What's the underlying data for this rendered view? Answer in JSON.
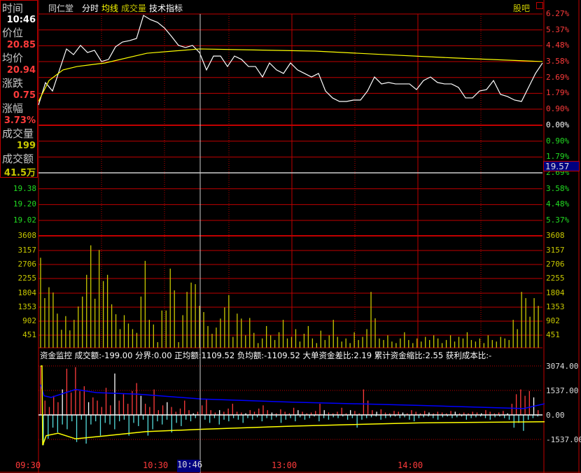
{
  "info_panel": {
    "time_label": "时间",
    "time_value": "10:46",
    "price_label": "价位",
    "price_value": "20.85",
    "avg_label": "均价",
    "avg_value": "20.94",
    "change_label": "涨跌",
    "change_value": "0.75",
    "pct_label": "涨幅",
    "pct_value": "3.73%",
    "volume_label": "成交量",
    "volume_value": "199",
    "amount_label": "成交额",
    "amount_value": "41.5万"
  },
  "header": {
    "stock_name": "同仁堂",
    "tabs": [
      "分时",
      "均线",
      "成交量",
      "技术指标"
    ],
    "guba": "股吧"
  },
  "price_axis_right": [
    "6.27%",
    "5.37%",
    "4.48%",
    "3.58%",
    "2.69%",
    "1.79%",
    "0.90%",
    "0.00%",
    "0.90%",
    "1.79%",
    "2.69%",
    "3.58%",
    "4.48%",
    "5.37%"
  ],
  "price_axis_left": [
    "19.38",
    "19.20",
    "19.02"
  ],
  "cursor_price": "19.57",
  "volume_axis": [
    "3608",
    "3157",
    "2706",
    "2255",
    "1804",
    "1353",
    "902",
    "451"
  ],
  "fund_monitor": {
    "text": "资金监控  成交额:-199.00  分界:0.00  正均额:1109.52  负均额:-1109.52  大单资金差比:2.19  累计资金缩比:2.55  获利成本比:-",
    "axis": [
      "3074.00",
      "1537.00",
      "0.00",
      "-1537.00"
    ]
  },
  "time_axis": [
    "09:30",
    "10:30",
    "10:46",
    "13:00",
    "14:00"
  ],
  "colors": {
    "up": "#ff3b3b",
    "down": "#22dd22",
    "avg": "#ffff00",
    "vol": "#c8c800",
    "grid": "#c00000",
    "cursor_bg": "#000080"
  },
  "chart_data": {
    "type": "line",
    "price_pct": [
      1.14,
      2.4,
      1.93,
      3.12,
      4.3,
      3.98,
      4.5,
      4.1,
      4.22,
      3.59,
      3.71,
      4.42,
      4.69,
      4.77,
      4.89,
      6.19,
      5.95,
      5.8,
      5.48,
      5.01,
      4.5,
      4.38,
      4.5,
      4.1,
      3.12,
      3.9,
      3.9,
      3.31,
      3.9,
      3.71,
      3.31,
      3.31,
      2.72,
      3.51,
      3.12,
      2.92,
      3.51,
      3.12,
      2.92,
      2.72,
      2.92,
      1.93,
      1.54,
      1.34,
      1.34,
      1.42,
      1.42,
      1.93,
      2.72,
      2.33,
      2.41,
      2.33,
      2.33,
      2.33,
      2.01,
      2.52,
      2.72,
      2.41,
      2.33,
      2.33,
      2.13,
      1.54,
      1.54,
      1.93,
      2.01,
      2.52,
      1.74,
      1.62,
      1.42,
      1.34,
      2.13,
      2.92,
      3.51
    ],
    "avg_pct": [
      [
        0,
        1.34
      ],
      [
        15,
        2.52
      ],
      [
        35,
        3.12
      ],
      [
        55,
        3.31
      ],
      [
        95,
        3.51
      ],
      [
        155,
        4.06
      ],
      [
        230,
        4.3
      ],
      [
        395,
        4.18
      ],
      [
        495,
        3.98
      ],
      [
        595,
        3.79
      ],
      [
        720,
        3.59
      ]
    ],
    "volume": [
      2900,
      1600,
      1950,
      1780,
      1100,
      580,
      1020,
      560,
      900,
      1330,
      1650,
      2350,
      3300,
      1580,
      3150,
      2150,
      2350,
      1400,
      1080,
      600,
      1050,
      780,
      600,
      480,
      1650,
      2800,
      900,
      750,
      180,
      1200,
      1200,
      2550,
      1850,
      180,
      1050,
      1800,
      2100,
      2050,
      1350,
      1150,
      700,
      450,
      650,
      940,
      1300,
      1700,
      350,
      1100,
      940,
      400,
      960,
      480,
      150,
      300,
      700,
      400,
      250,
      500,
      900,
      300,
      350,
      600,
      200,
      450,
      700,
      300,
      150,
      550,
      250,
      400,
      900,
      350,
      200,
      300,
      150,
      500,
      250,
      350,
      600,
      1800,
      950,
      300,
      250,
      400,
      200,
      150,
      300,
      500,
      250,
      150,
      300,
      200,
      350,
      250,
      400,
      300,
      150,
      250,
      400,
      200,
      350,
      300,
      500,
      250,
      200,
      300,
      150,
      400,
      250,
      200,
      350,
      300,
      250,
      900,
      600,
      1800,
      1600,
      1000,
      1600,
      1350
    ],
    "fund_pos": [
      3074,
      900,
      500,
      1200,
      800,
      1600,
      2900,
      1400,
      3000,
      1500,
      1800,
      800,
      1100,
      900,
      500,
      1700,
      600,
      2600,
      900,
      1300,
      700,
      1500,
      2000,
      1200,
      700,
      500,
      1600,
      300,
      600,
      800,
      500,
      200,
      400,
      900,
      300,
      100,
      200,
      600,
      1000,
      300,
      150,
      300,
      200,
      400,
      700,
      200,
      150,
      100,
      300,
      200,
      400,
      600,
      300,
      150,
      100,
      350,
      200,
      100,
      450,
      300,
      200,
      100,
      150,
      250,
      700,
      300,
      150,
      100,
      200,
      450,
      100,
      300,
      250,
      100,
      1600,
      900,
      300,
      200,
      350,
      150,
      100,
      250,
      200,
      150,
      100,
      300,
      200,
      100,
      250,
      150,
      100,
      200,
      150,
      100,
      250,
      200,
      100,
      150,
      100,
      200,
      150,
      100,
      300,
      200,
      100,
      150,
      250,
      100,
      700,
      1300,
      1600,
      1200,
      1500,
      1100,
      300
    ],
    "fund_neg": [
      -1900,
      -1500,
      -800,
      -1100,
      -600,
      -900,
      -400,
      -1700,
      -300,
      -1800,
      -600,
      -400,
      -1300,
      -500,
      -600,
      -900,
      -400,
      -300,
      -1300,
      -500,
      -700,
      -300,
      -1300,
      -900,
      -400,
      -600,
      -300,
      -1100,
      -500,
      -700,
      -300,
      -400,
      -200,
      -800,
      -300,
      -500,
      -200,
      -600,
      -300,
      -400,
      -200,
      -300,
      -500,
      -200,
      -300,
      -150,
      -400,
      -200,
      -300,
      -150,
      -500,
      -300,
      -200,
      -400,
      -150,
      -300,
      -200,
      -100,
      -400,
      -200,
      -300,
      -150,
      -200,
      -100,
      -300,
      -200,
      -800,
      -300,
      -200,
      -150,
      -100,
      -300,
      -200,
      -150,
      -100,
      -200,
      -150,
      -300,
      -400,
      -200,
      -150,
      -100,
      -200,
      -300,
      -150,
      -100,
      -200,
      -150,
      -100,
      -300,
      -200,
      -150,
      -100,
      -200,
      -300,
      -150,
      -100,
      -200,
      -300,
      -800,
      -500,
      -1000,
      -300,
      -200,
      -100
    ],
    "fund_blue": [
      [
        0,
        1900
      ],
      [
        5,
        1200
      ],
      [
        15,
        1100
      ],
      [
        50,
        1600
      ],
      [
        80,
        1400
      ],
      [
        140,
        1300
      ],
      [
        230,
        1000
      ],
      [
        360,
        800
      ],
      [
        540,
        600
      ],
      [
        690,
        400
      ],
      [
        720,
        700
      ]
    ],
    "fund_yellow": [
      [
        0,
        3074
      ],
      [
        2,
        3074
      ],
      [
        3,
        -1900
      ],
      [
        8,
        -1300
      ],
      [
        25,
        -1150
      ],
      [
        50,
        -1500
      ],
      [
        95,
        -1300
      ],
      [
        150,
        -1050
      ],
      [
        230,
        -900
      ],
      [
        360,
        -700
      ],
      [
        540,
        -500
      ],
      [
        720,
        -430
      ]
    ],
    "pct_range": [
      -6.27,
      6.27
    ],
    "volume_max": 3608,
    "fund_range": [
      -1537,
      3074
    ]
  }
}
